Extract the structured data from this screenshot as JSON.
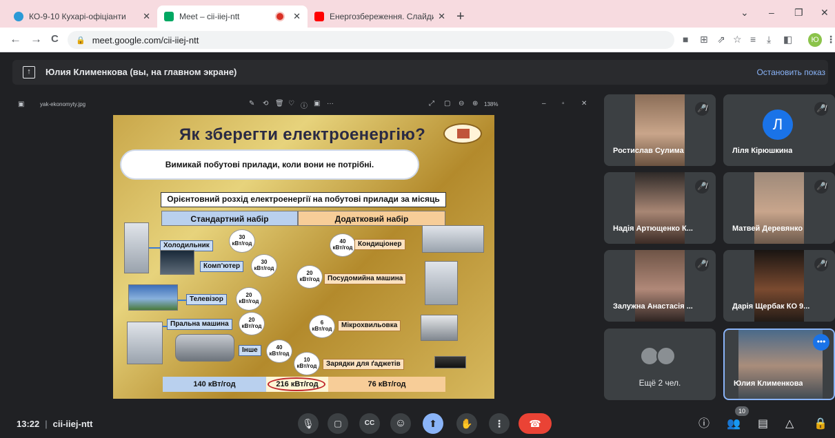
{
  "browser": {
    "tabs": [
      {
        "label": "КО-9-10 Кухарі-офіціанти",
        "close": "✕",
        "favicon_color": "#2c9ad6"
      },
      {
        "label": "Meet – cii-iiej-ntt",
        "close": "✕",
        "favicon_color": "#00a862"
      },
      {
        "label": "Енергозбереження. Слайди до",
        "close": "✕",
        "favicon_color": "#ff0000"
      }
    ],
    "new_tab": "+",
    "window_controls": {
      "dropdown": "⌄",
      "minimize": "–",
      "restore": "❐",
      "close": "✕"
    },
    "back": "←",
    "forward": "→",
    "reload": "C",
    "url": "meet.google.com/cii-iiej-ntt",
    "profile_initial": "Ю"
  },
  "presentation": {
    "banner_text": "Юлия Клименкова (вы, на главном экране)",
    "stop_label": "Остановить показ",
    "file_name": "yak-ekonomyty.jpg",
    "zoom": "138%",
    "viewer_tools": [
      "✎",
      "⟲",
      "🗑",
      "♡",
      "ⓘ",
      "▣",
      "···"
    ],
    "viewer_right_tools": [
      "⤢",
      "▢",
      "⊖",
      "⊕"
    ],
    "window_buttons": [
      "–",
      "▫",
      "✕"
    ]
  },
  "slide": {
    "title": "Як зберегти  електроенергію?",
    "cloud_text": "Вимикай побутові прилади, коли вони не потрібні.",
    "subtitle": "Орієнтовний розхід електроенергії на побутові прилади за місяць",
    "standard_header": "Стандартний набір",
    "extra_header": "Додатковий набір",
    "standard_items": [
      {
        "label": "Холодильник",
        "value": "30",
        "unit": "кВт/год"
      },
      {
        "label": "Комп’ютер",
        "value": "30",
        "unit": "кВт/год"
      },
      {
        "label": "Телевізор",
        "value": "20",
        "unit": "кВт/год"
      },
      {
        "label": "Пральна машина",
        "value": "20",
        "unit": "кВт/год"
      },
      {
        "label": "Інше",
        "value": "40",
        "unit": "кВт/год"
      }
    ],
    "extra_items": [
      {
        "label": "Кондиціонер",
        "value": "40",
        "unit": "кВт/год"
      },
      {
        "label": "Посудомийна машина",
        "value": "20",
        "unit": "кВт/год"
      },
      {
        "label": "Мікрохвильовка",
        "value": "6",
        "unit": "кВт/год"
      },
      {
        "label": "Зарядки для ґаджетів",
        "value": "10",
        "unit": "кВт/год"
      }
    ],
    "totals": {
      "standard": "140 кВт/год",
      "combined": "216 кВт/год",
      "extra": "76 кВт/год"
    }
  },
  "participants": [
    {
      "name": "Ростислав Сулима",
      "muted": true,
      "has_video": true
    },
    {
      "name": "Ліля Кірюшкина",
      "muted": true,
      "has_video": false,
      "initial": "Л"
    },
    {
      "name": "Надія Артющенко К...",
      "muted": true,
      "has_video": true
    },
    {
      "name": "Матвей Деревянко",
      "muted": true,
      "has_video": true
    },
    {
      "name": "Залужна Анастасія ...",
      "muted": true,
      "has_video": true
    },
    {
      "name": "Дарія Щербак КО 9...",
      "muted": true,
      "has_video": true
    }
  ],
  "more_tile": {
    "label": "Ещё 2 чел."
  },
  "self_tile": {
    "name": "Юлия Клименкова",
    "menu": "•••"
  },
  "meeting": {
    "time": "13:22",
    "separator": "|",
    "code": "cii-iiej-ntt",
    "participant_count": "10"
  },
  "controls": {
    "mic": "🎙",
    "camera": "▢",
    "captions": "CC",
    "emoji": "☺",
    "present": "⬆",
    "raise_hand": "✋",
    "more": "⋮",
    "leave": "☎"
  },
  "right_controls": {
    "info": "ⓘ",
    "people": "👥",
    "chat": "▤",
    "activities": "△",
    "host": "🔒"
  },
  "colors": {
    "accent": "#8ab4f8",
    "leave": "#ea4335",
    "background": "#202124",
    "tab_strip": "#f7dbe0"
  }
}
